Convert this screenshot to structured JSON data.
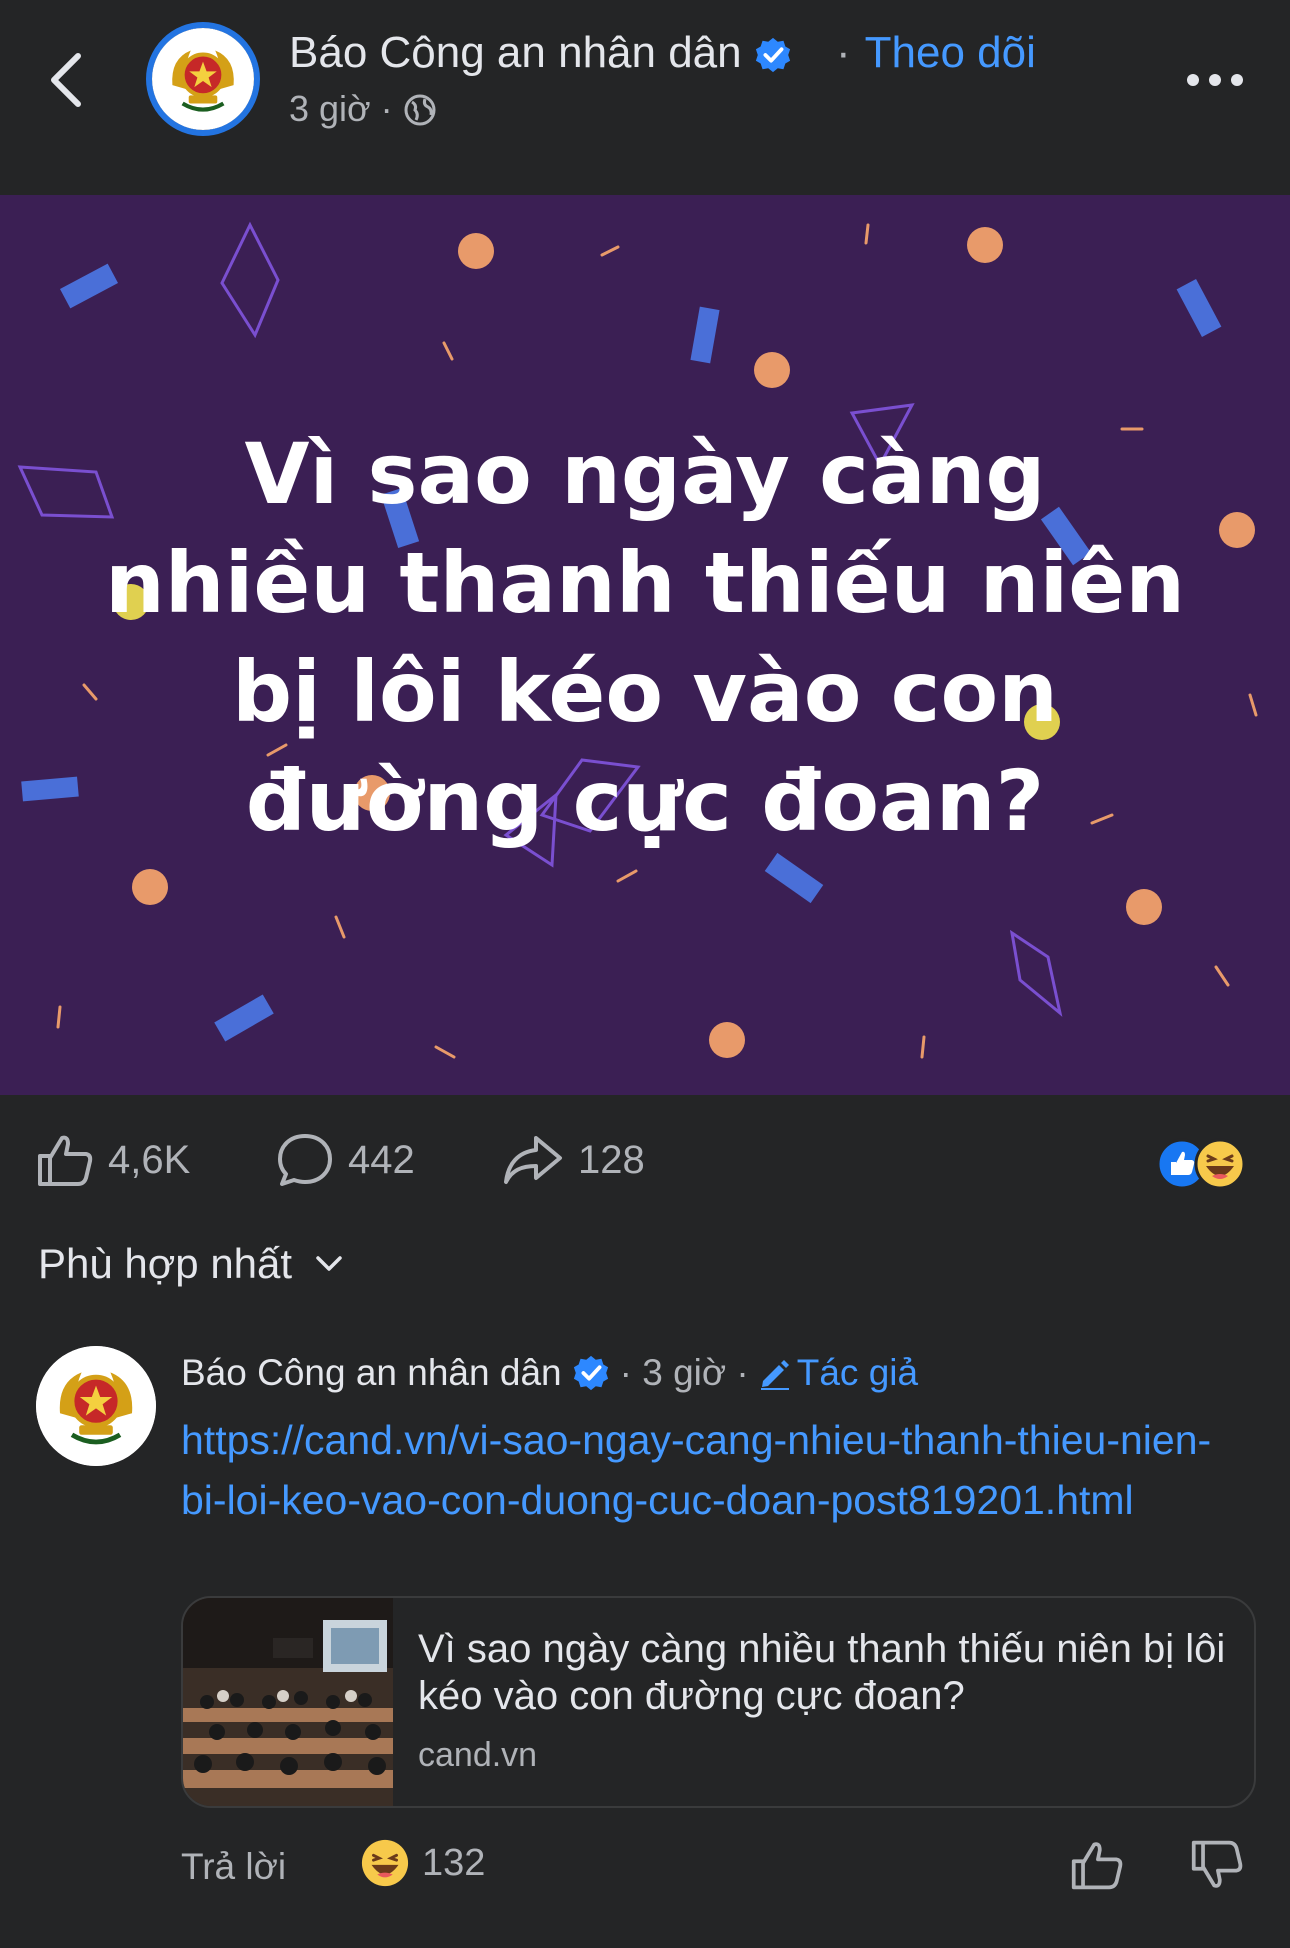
{
  "header": {
    "page_name": "Báo Công an nhân dân",
    "follow_label": "Theo dõi",
    "follow_separator": "·",
    "time": "3 giờ",
    "meta_separator": "·",
    "accent_color": "#4599ff"
  },
  "post": {
    "headline": "Vì sao ngày càng nhiều thanh thiếu niên bị lôi kéo vào con đường cực đoan?",
    "banner_color": "#3b1f54",
    "stats": {
      "likes": "4,6K",
      "comments": "442",
      "shares": "128"
    }
  },
  "sort": {
    "label": "Phù hợp nhất"
  },
  "comment": {
    "author": "Báo Công an nhân dân",
    "meta": "· 3 giờ ·",
    "author_badge": "Tác giả",
    "link": "https://cand.vn/vi-sao-ngay-cang-nhieu-thanh-thieu-nien-bi-loi-keo-vao-con-duong-cuc-doan-post819201.html",
    "link_card": {
      "title": "Vì sao ngày càng nhiều thanh thiếu niên bị lôi kéo vào con đường cực đoan?",
      "domain": "cand.vn"
    },
    "reply_label": "Trả lời",
    "reaction_count": "132"
  },
  "icons": {
    "back": "chevron-left-icon",
    "verified": "verified-badge-icon",
    "globe": "globe-icon",
    "more": "more-dots-icon",
    "like": "thumbs-up-icon",
    "comment": "comment-bubble-icon",
    "share": "share-arrow-icon",
    "sort": "chevron-down-icon",
    "pencil": "pencil-icon",
    "haha": "haha-emoji-icon",
    "dislike": "thumbs-down-icon"
  }
}
